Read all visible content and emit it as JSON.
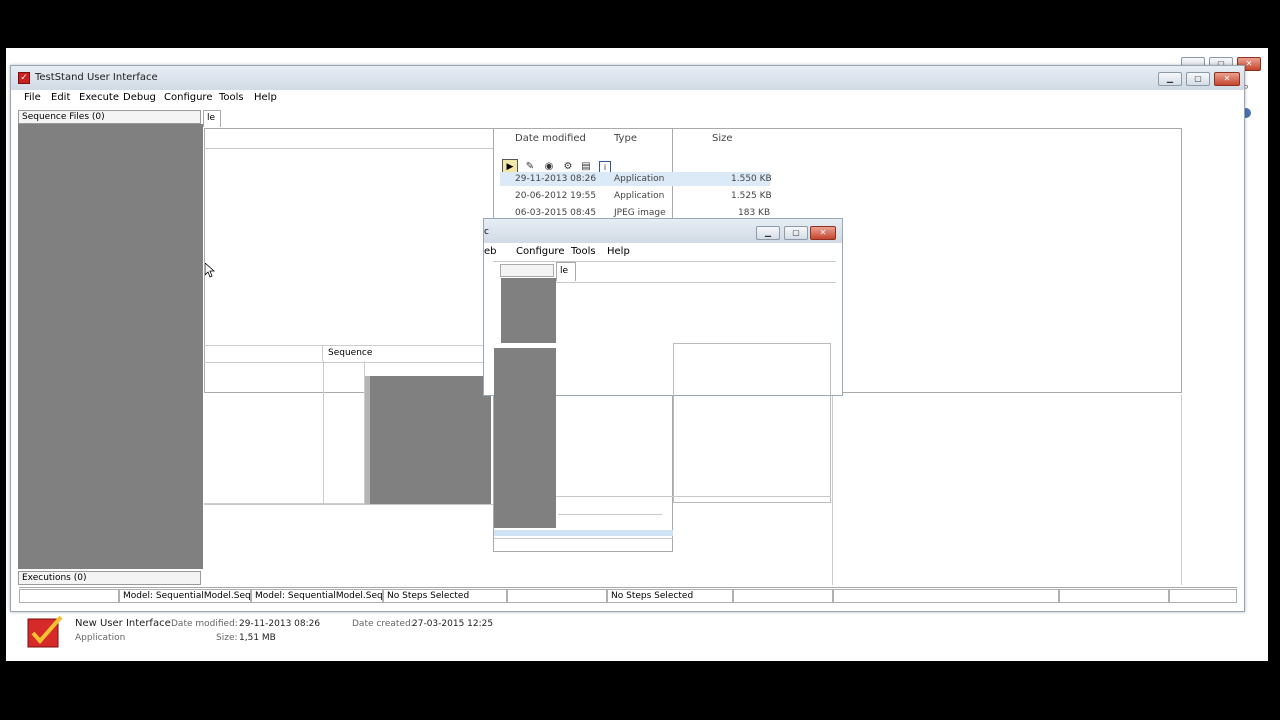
{
  "window": {
    "title": "TestStand User Interface",
    "menu": [
      "File",
      "Edit",
      "Execute",
      "Debug",
      "Configure",
      "Tools",
      "Help"
    ]
  },
  "left_panel": {
    "sequence_files_header": "Sequence Files (0)",
    "executions_header": "Executions (0)"
  },
  "tab_fragment": "le",
  "sequence_header": "Sequence",
  "explorer": {
    "columns": [
      "Date modified",
      "Type",
      "Size"
    ],
    "rows": [
      {
        "date": "29-11-2013 08:26",
        "type": "Application",
        "size": "1.550 KB"
      },
      {
        "date": "20-06-2012 19:55",
        "type": "Application",
        "size": "1.525 KB"
      },
      {
        "date": "06-03-2015 08:45",
        "type": "JPEG image",
        "size": "183 KB"
      }
    ]
  },
  "second_window": {
    "title_fragment": "c",
    "menu": [
      "eb",
      "Configure",
      "Tools",
      "Help"
    ],
    "tab_fragment": "le"
  },
  "statusbar": {
    "cells": [
      "",
      "Model: SequentialModel.Seq",
      "Model: SequentialModel.Seq",
      "No Steps Selected",
      "",
      "No Steps Selected",
      "",
      "",
      "",
      ""
    ]
  },
  "details": {
    "name": "New User Interface",
    "type": "Application",
    "date_modified_label": "Date modified:",
    "date_modified": "29-11-2013 08:26",
    "date_created_label": "Date created:",
    "date_created": "27-03-2015 12:25",
    "size_label": "Size:",
    "size": "1,51 MB"
  },
  "colors": {
    "accent_red": "#cc1f1f",
    "panel_gray": "#808080",
    "selection_blue": "#dce9f7"
  }
}
